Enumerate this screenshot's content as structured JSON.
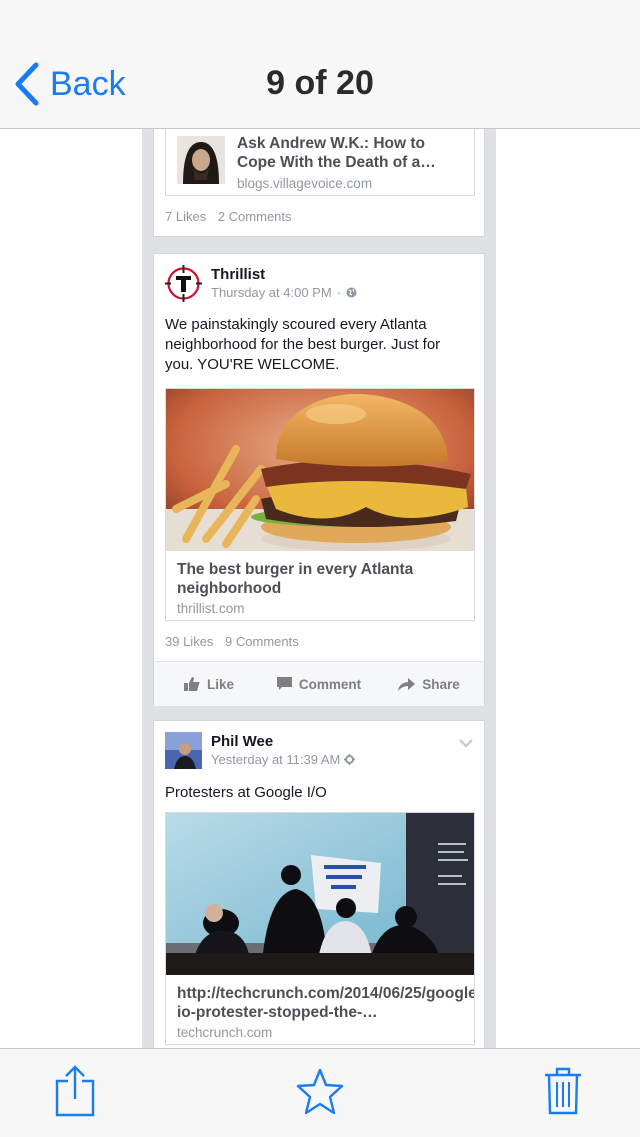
{
  "nav": {
    "back_label": "Back",
    "title": "9 of 20"
  },
  "colors": {
    "accent": "#1a7cf4",
    "text": "#141823",
    "muted": "#9197a3"
  },
  "post1": {
    "link_title": "Ask Andrew W.K.: How to Cope With the Death of a…",
    "link_domain": "blogs.villagevoice.com",
    "likes": "7 Likes",
    "comments": "2 Comments"
  },
  "post2": {
    "author": "Thrillist",
    "time": "Thursday at 4:00 PM",
    "visibility_icon": "globe-icon",
    "text": "We painstakingly scoured every Atlanta neighborhood for the best burger. Just for you. YOU'RE WELCOME.",
    "link_title": "The best burger in every Atlanta neighborhood",
    "link_domain": "thrillist.com",
    "likes": "39 Likes",
    "comments": "9 Comments",
    "actions": {
      "like": "Like",
      "comment": "Comment",
      "share": "Share"
    }
  },
  "post3": {
    "author": "Phil Wee",
    "time": "Yesterday at 11:39 AM",
    "visibility_icon": "gear-icon",
    "text": "Protesters at Google I/O",
    "link_title": "http://techcrunch.com/2014/06/25/google-io-protester-stopped-the-…",
    "link_domain": "techcrunch.com"
  },
  "toolbar": {
    "share_icon": "share-icon",
    "favorite_icon": "star-icon",
    "delete_icon": "trash-icon"
  }
}
